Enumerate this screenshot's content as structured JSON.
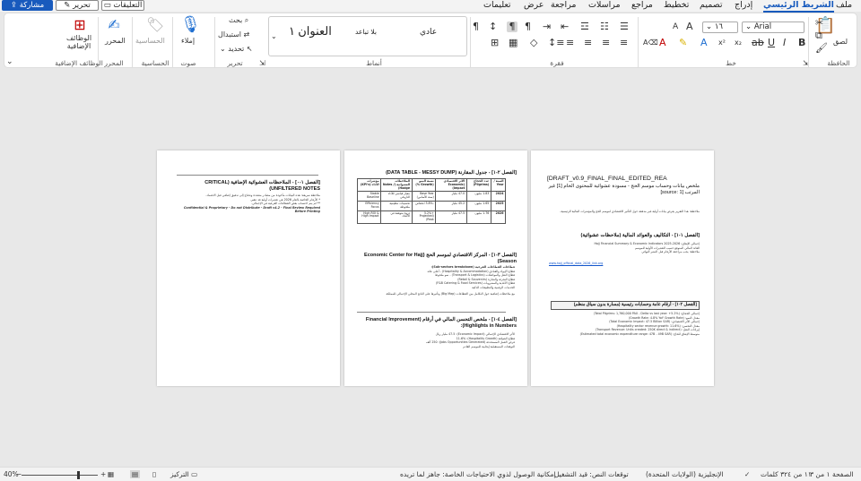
{
  "tabs": [
    "ملف",
    "الشريط الرئيسي",
    "إدراج",
    "تصميم",
    "تخطيط",
    "مراجع",
    "مراسلات",
    "مراجعة",
    "عرض",
    "تعليمات"
  ],
  "topbar": {
    "share": "مشاركة",
    "edit": "تحرير",
    "comments": "التعليقات"
  },
  "ribbon": {
    "clipboard": {
      "label": "الحافظة",
      "paste": "لصق"
    },
    "font": {
      "label": "خط",
      "name": "Arial",
      "size": "١٦"
    },
    "paragraph": {
      "label": "فقرة"
    },
    "styles": {
      "label": "أنماط",
      "items": [
        "عادي",
        "بلا تباعد",
        "العنوان ١"
      ]
    },
    "editing": {
      "label": "تحرير",
      "find": "بحث",
      "replace": "استبدال",
      "select": "تحديد"
    },
    "voice": {
      "label": "صوت",
      "dictate": "إملاء"
    },
    "sensitivity": {
      "label": "الحساسية",
      "button": "الحساسية"
    },
    "editor": {
      "label": "المحرر",
      "button": "المحرر"
    },
    "addins": {
      "label": "الوظائف الإضافية",
      "button": "الوظائف الإضافية"
    }
  },
  "pages": {
    "page1": {
      "title": "[DRAFT_v0.9_FINAL_FINAL_EDITED_REA",
      "subtitle": "ملخص بيانات وحساب موسم الحج - مسودة عشوائية للمحتوى الخام [1] غير المرتب [source: 1]",
      "intro": "ملاحظة: هذا التقرير يعرض بيانات أولية غير مدققة حول التأثير الاقتصادي لموسم الحج والمؤشرات المالية الرئيسية.",
      "section1": "[الفصل ١-١] - التكاليف والعوائد المالية (ملاحظات عشوائية)",
      "s1_lines": [
        "إجمالي الإنفاق: Hajj Financial Summary & Economic Indicators 2025-2026",
        "العائد المالي المتوقع حسب التقديرات الأولية للموسم",
        "ملاحظة: يجب مراجعة الأرقام قبل النشر النهائي"
      ],
      "link": "www.hajj_official_data_2026_link.org",
      "section2": "[الفصل ٢-١] - أرقام عامة وحسابات رئيسية (مسارة بدون سياق منظم)",
      "s2_lines": [
        "إجمالي الحجاج: (Total Pilgrims: 1,760,000 PAX - Delta vs last year: +5.2%)",
        "معدل النمو: (Growth Rate: 4.8% YoY Growth Rate)",
        "إجمالي الأثر الاقتصادي: (Total Economic Impact: 47.5 Billion SAR)",
        "معدل التحسن: (Hospitality sector revenue growth: 11.6%)",
        "إيرادات النقل: (Transport Revenue: Units created: 250K direct & indirect)",
        "متوسط الإنفاق للحاج: (Estimated total economic expenditure range: 47B - 49B SAR)"
      ]
    },
    "page2": {
      "title": "[الفصل ٢-١] - جدول المقارنة (DATA TABLE - MESSY DUMP)",
      "table": [
        [
          "السنة / Year",
          "عدد الحجاج (Pilgrims)",
          "الأثر الاقتصادي (Economic Impact)",
          "نسبة النمو (Growth %)",
          "الملاحظات العشوائية (Notes / Hodge)",
          "مؤشرات الأداء (KPI's)"
        ],
        [
          "2024",
          "1.83 مليون",
          "47.0 مليار",
          "Base Year (سنة الأساس)",
          "معيار قياسي للأداء التاريخي",
          "Stable Baseline"
        ],
        [
          "2025",
          "1.65 مليون",
          "45.2 مليار",
          "-3.8% انخفاض",
          "تحسينات تنظيمية ملحوظة",
          "Efficiency Focus"
        ],
        [
          "2026",
          "1.76 مليون",
          "47.5 مليار",
          "+5.2% (Projected Peak)",
          "ذروة متوقعة في الأعداد",
          "High ROI & High Impact"
        ]
      ],
      "section2": "[الفصل ٣-١] - المركز الاقتصادي لموسم الحج (Economic Center for Hajj Season)",
      "s2_head": "قطاعات القطاعات الفرعية (Sub-sectors breakdown):",
      "s2_lines": [
        "قطاع الإيواء والفنادق (Hospitality & Accommodation) - أعلى عائد",
        "قطاع النقل والمواصلات (Transport & Logistics) - نمو ملحوظ",
        "قطاع التجزئة والتجارة (Retail & Souvenirs)",
        "قطاع الأغذية والمشروبات (F&B Catering & Food Services)",
        "الخدمات الرقمية والتطبيقات الذكية"
      ],
      "s2_note": "مع ملاحظات إضافية حول التكامل بين القطاعات (Big Map) وتأثيرها على الناتج المحلي الإجمالي للمملكة.",
      "section3": "[الفصل ٤-١] - ملخص التحسن المالي في أرقام (Financial Improvement Highlights in Numbers):",
      "s3_lines": [
        "الأثر الاقتصادي الإجمالي (Economic Impact): 47.5 مليار ريال",
        "قطاع الضيافة (Hospitality Growth): 11.6%",
        "فرص العمل المستحدثة (Jobs Opportunities Generated): 250 ألف",
        "التوقعات المستقبلية إيجابية للموسم القادم"
      ]
    },
    "page3": {
      "title": "[الفصل ١-٠] - الملاحظات العشوائية الإضافية (CRITICAL UNFILTERED NOTES)",
      "lines": [
        "ملاحظة سريعة: هذه البيانات مأخوذة من مصادر متعددة وتحتاج إلى تدقيق إضافي قبل الاعتماد.",
        "* الأرقام الخاصة بالعام 2026 هي تقديرات أولية قد تتغير.",
        "** لم يتم احتساب بعض القطاعات الفرعية في الإجمالي.",
        "Confidential & Proprietary - Do not Distribute - Draft v4.2 - Final Review Required Before Printing"
      ]
    }
  },
  "status": {
    "page": "الصفحة ١ من ٣",
    "words": "١١ من ٣٢٤ كلمات",
    "lang": "الإنجليزية (الولايات المتحدة)",
    "predict": "توقعات النص: قيد التشغيل",
    "access": "إمكانية الوصول لذوي الاحتياجات الخاصة: جاهز لما تريده",
    "focus": "التركيز",
    "zoom": "40%"
  }
}
